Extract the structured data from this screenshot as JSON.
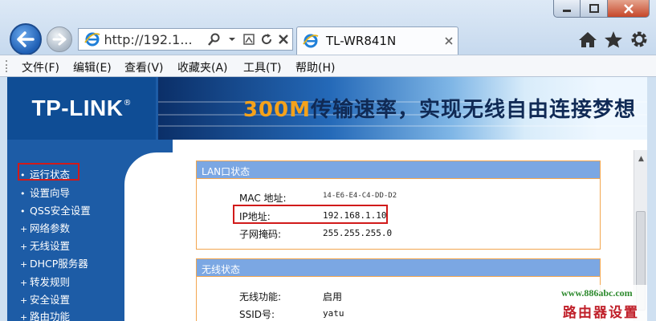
{
  "browser": {
    "address_text": "http://192.1...",
    "tab_title": "TL-WR841N"
  },
  "menu": {
    "items": [
      "文件(F)",
      "编辑(E)",
      "查看(V)",
      "收藏夹(A)",
      "工具(T)",
      "帮助(H)"
    ]
  },
  "banner": {
    "logo": "TP-LINK",
    "logo_mark": "®",
    "slogan_number": "300M",
    "slogan_text": "传输速率，实现无线自由连接梦想"
  },
  "sidebar": {
    "items": [
      "运行状态",
      "设置向导",
      "QSS安全设置",
      "网络参数",
      "无线设置",
      "DHCP服务器",
      "转发规则",
      "安全设置",
      "路由功能"
    ]
  },
  "lan": {
    "heading": "LAN口状态",
    "mac_label": "MAC 地址:",
    "mac_value": "14-E6-E4-C4-DD-D2",
    "ip_label": "IP地址:",
    "ip_value": "192.168.1.10",
    "mask_label": "子网掩码:",
    "mask_value": "255.255.255.0"
  },
  "wireless": {
    "heading": "无线状态",
    "func_label": "无线功能:",
    "func_value": "启用",
    "ssid_label": "SSID号:",
    "ssid_value": "yatu"
  },
  "watermark": {
    "url": "www.886abc.com",
    "text": "路由器设置"
  },
  "colors": {
    "banner_blue": "#1d5ca6",
    "section_head": "#7ba7e3",
    "section_border": "#f3a64f",
    "highlight_red": "#d11a1a"
  }
}
